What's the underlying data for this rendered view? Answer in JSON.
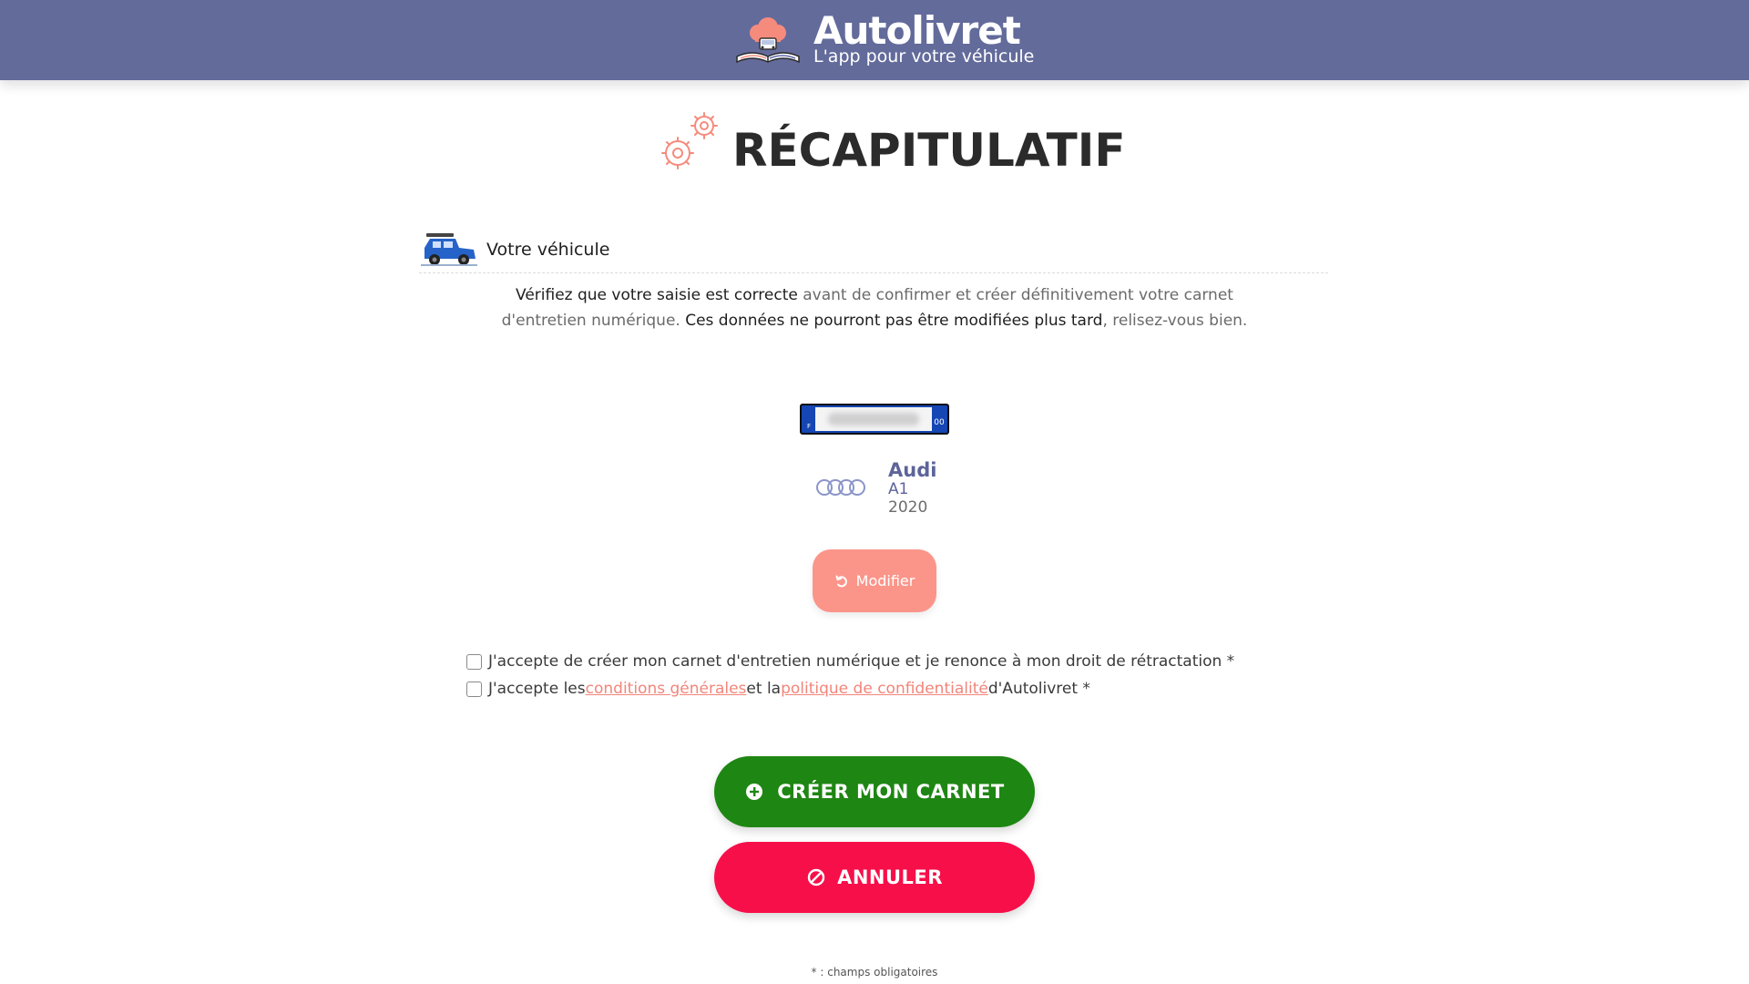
{
  "header": {
    "brand_name": "Autolivret",
    "tagline": "L'app pour votre véhicule",
    "colors": {
      "bar": "#636b9b",
      "accent": "#f2857a"
    }
  },
  "page": {
    "title": "RÉCAPITULATIF",
    "title_icon": "gears-icon"
  },
  "section": {
    "title": "Votre véhicule",
    "icon": "car-icon"
  },
  "notice": {
    "part1_strong": "Vérifiez que votre saisie est correcte",
    "part2": " avant de confirmer et créer définitivement votre carnet d'entretien numérique. ",
    "part3_strong": "Ces données ne pourront pas être modifiées plus tard",
    "part4": ", relisez-vous bien."
  },
  "plate": {
    "country": "F",
    "region": "00"
  },
  "vehicle": {
    "brand": "Audi",
    "model": "A1",
    "year": "2020",
    "logo": "audi-rings-logo"
  },
  "modify_button": {
    "label": "Modifier",
    "icon": "undo-icon"
  },
  "consents": {
    "retraction": "J'accepte de créer mon carnet d'entretien numérique et je renonce à mon droit de rétractation *",
    "terms_prefix": "J'accepte les ",
    "terms_link": "conditions générales",
    "terms_mid": " et la ",
    "privacy_link": "politique de confidentialité",
    "terms_suffix": " d'Autolivret *",
    "checked": [
      false,
      false
    ]
  },
  "actions": {
    "create_label": "CRÉER MON CARNET",
    "create_icon": "plus-circle-icon",
    "create_color": "#1e8613",
    "cancel_label": "ANNULER",
    "cancel_icon": "ban-icon",
    "cancel_color": "#f70f4a"
  },
  "footnote": "* : champs obligatoires"
}
